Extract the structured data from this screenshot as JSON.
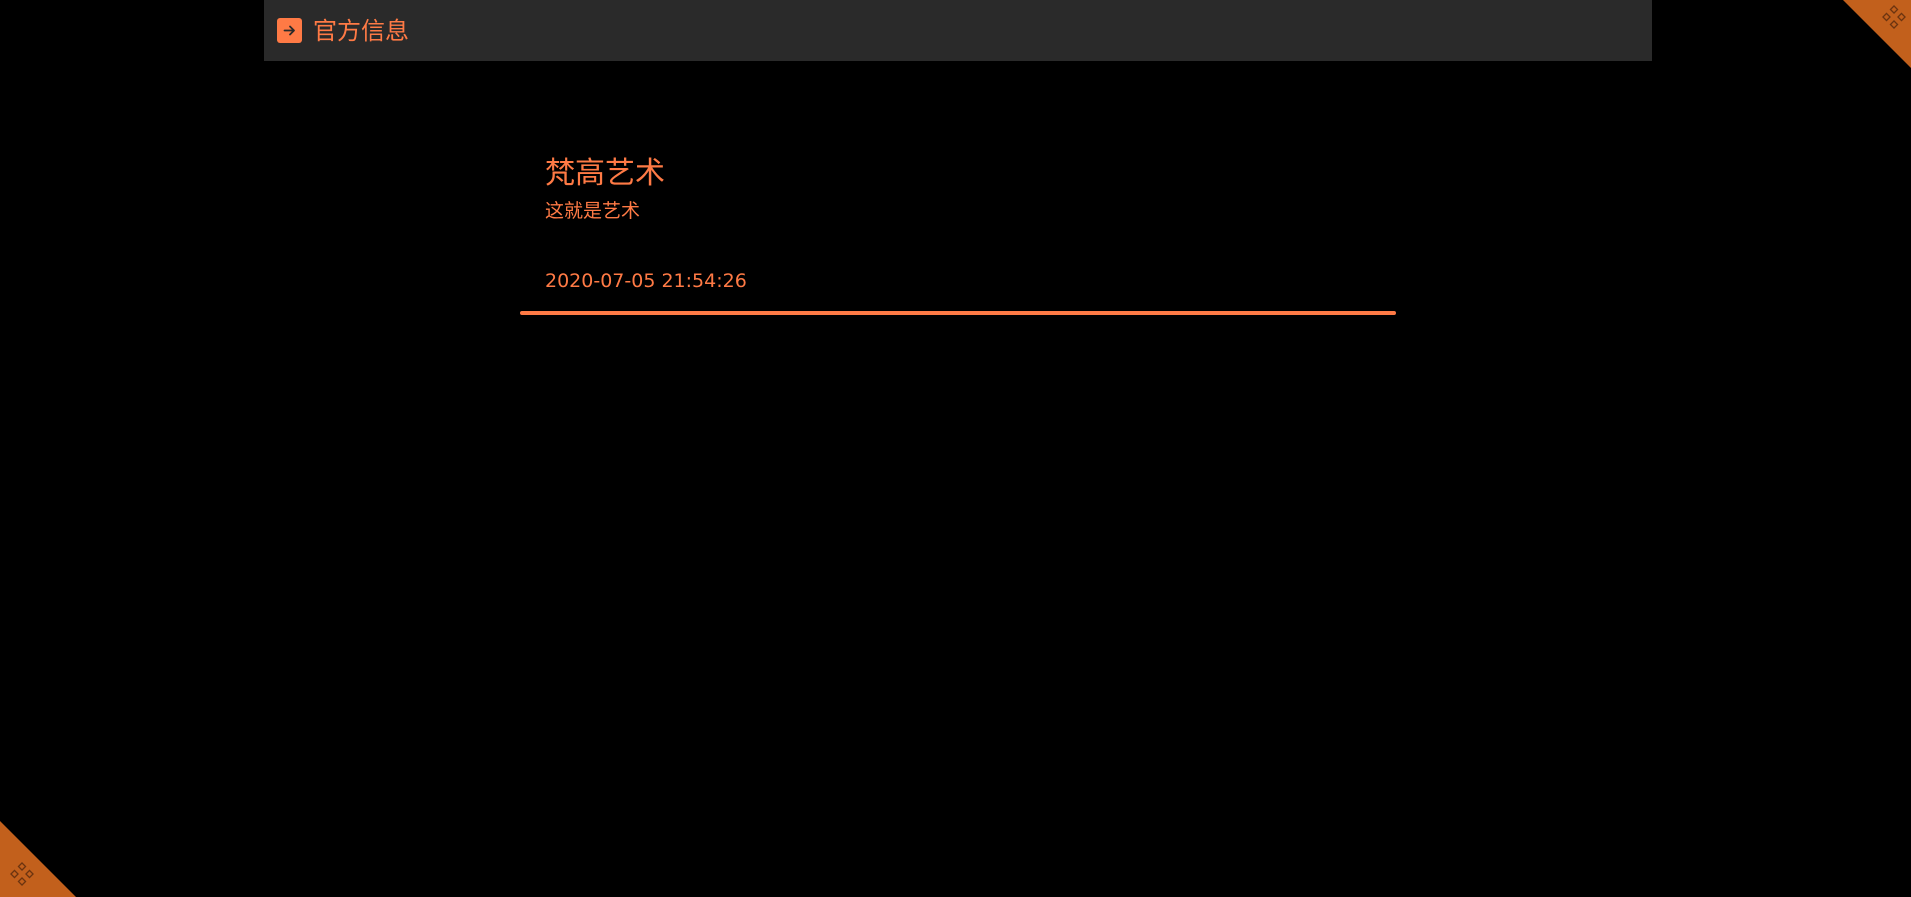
{
  "header": {
    "back_icon": "arrow-right-icon",
    "title": "官方信息"
  },
  "article": {
    "title": "梵高艺术",
    "subtitle": "这就是艺术",
    "timestamp": "2020-07-05 21:54:26"
  },
  "decorations": {
    "corner_icon": "diamond-grid-icon"
  },
  "colors": {
    "accent": "#ff7a45",
    "header_bg": "#2a2a2a",
    "page_bg": "#000000",
    "corner": "#c2601c"
  }
}
